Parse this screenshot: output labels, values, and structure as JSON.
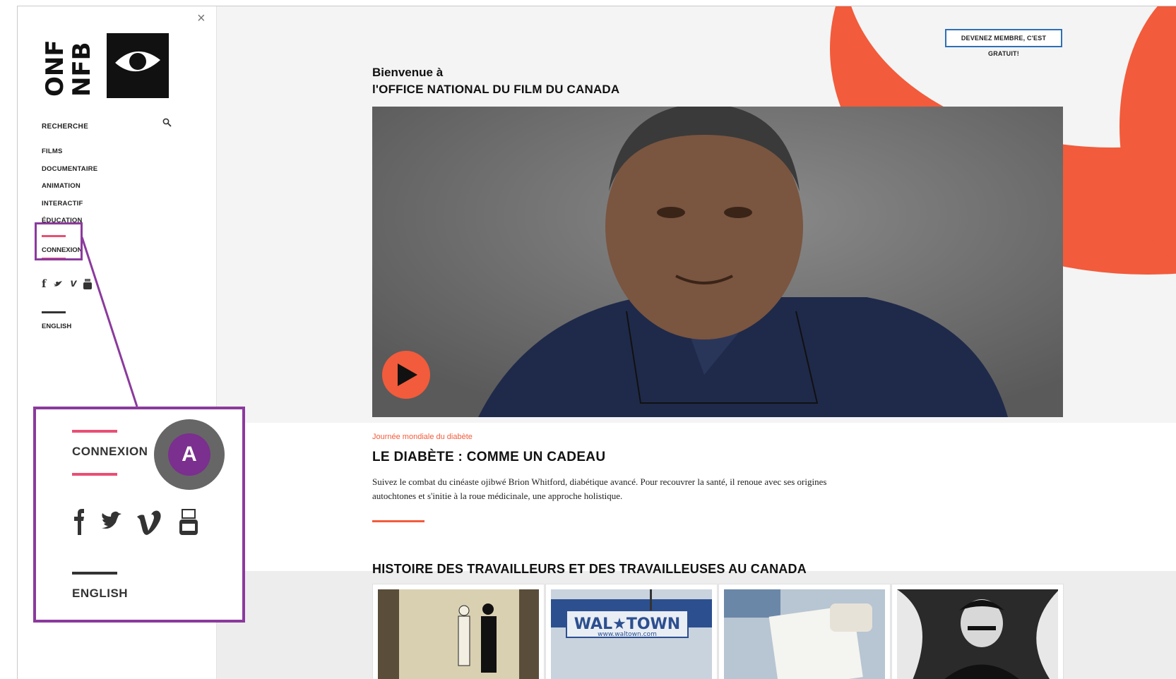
{
  "sidebar": {
    "logo_text_left": "ONF",
    "logo_text_right": "NFB",
    "close_symbol": "×",
    "search_label": "RECHERCHE",
    "nav_items": [
      "FILMS",
      "DOCUMENTAIRE",
      "ANIMATION",
      "INTERACTIF",
      "ÉDUCATION"
    ],
    "connexion": "CONNEXION",
    "language": "ENGLISH"
  },
  "header": {
    "member_button": "DEVENEZ MEMBRE, C'EST GRATUIT!"
  },
  "welcome": {
    "line1": "Bienvenue à",
    "line2": "l'OFFICE NATIONAL DU FILM DU CANADA"
  },
  "feature": {
    "kicker": "Journée mondiale du diabète",
    "title": "LE DIABÈTE : COMME UN CADEAU",
    "description": "Suivez le combat du cinéaste ojibwé Brion Whitford, diabétique avancé. Pour recouvrer la santé, il renoue avec ses origines autochtones et s'initie à la roue médicinale, une approche holistique."
  },
  "section": {
    "title": "HISTOIRE DES TRAVAILLEURS ET DES TRAVAILLEUSES AU CANADA",
    "thumb_text": "WAL★TOWN",
    "thumb_url": "www.waltown.com"
  },
  "callout": {
    "connexion": "CONNEXION",
    "language": "ENGLISH",
    "badge": "A"
  },
  "icons": {
    "social": [
      "facebook-icon",
      "twitter-icon",
      "vimeo-icon",
      "youtube-icon"
    ]
  },
  "colors": {
    "accent": "#f25b3b",
    "pink": "#e94f74",
    "highlight": "#8b3a9d",
    "member_border": "#2f6fb6"
  }
}
